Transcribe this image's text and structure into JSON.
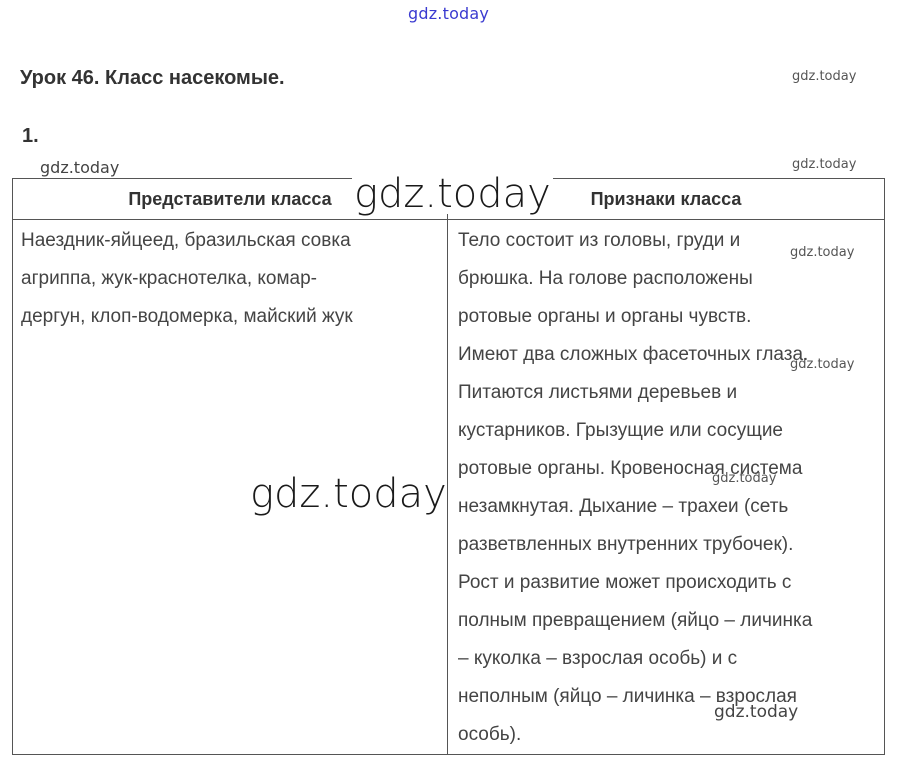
{
  "watermarks": {
    "top": "gdz.today",
    "small_1": "gdz.today",
    "small_2": "gdz.today",
    "small_3": "gdz.today",
    "small_4": "gdz.today",
    "small_5": "gdz.today",
    "small_6": "gdz.today",
    "small_7": "gdz.today",
    "medium_bottom": "gdz.today",
    "big_header": "gdz.today",
    "big_middle": "gdz.today"
  },
  "lesson": {
    "title": "Урок 46. Класс насекомые.",
    "task_number": "1."
  },
  "table": {
    "headers": [
      "Представители класса",
      "Признаки класса"
    ],
    "representatives_lines": [
      "Наездник-яйцеед, бразильская совка",
      "агриппа, жук-краснотелка, комар-",
      "дергун, клоп-водомерка, майский жук"
    ],
    "features_lines": [
      "Тело состоит из головы, груди и",
      "брюшка. На голове расположены",
      "ротовые органы и органы чувств.",
      "Имеют два сложных фасеточных глаза.",
      "Питаются листьями деревьев и",
      "кустарников. Грызущие или сосущие",
      "ротовые органы. Кровеносная система",
      "незамкнутая. Дыхание – трахеи (сеть",
      "разветвленных внутренних трубочек).",
      "Рост и развитие может происходить с",
      "полным превращением (яйцо – личинка",
      "– куколка – взрослая особь) и с",
      "неполным (яйцо – личинка – взрослая",
      "особь)."
    ]
  }
}
